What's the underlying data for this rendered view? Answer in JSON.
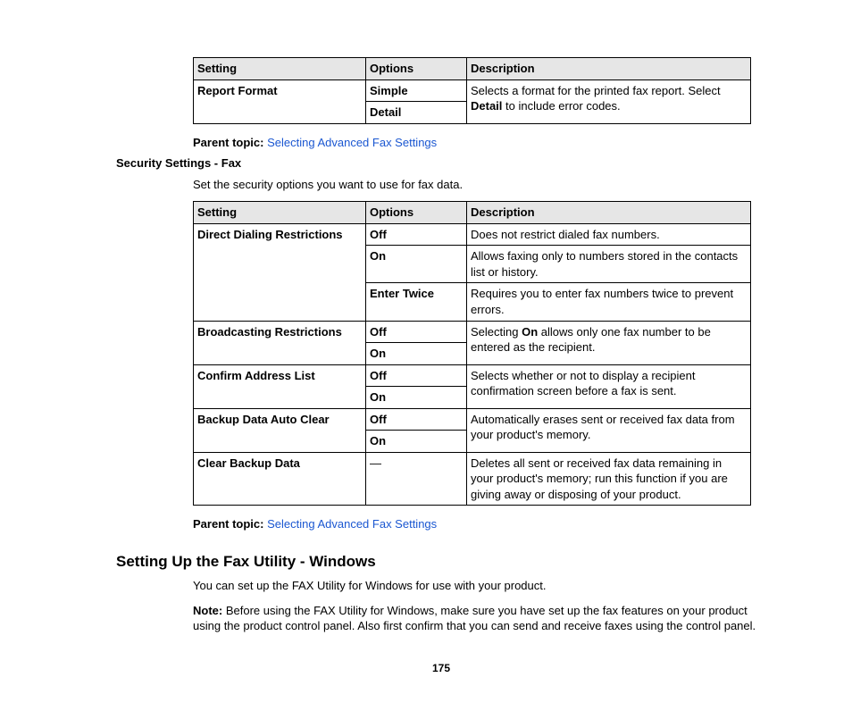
{
  "table1": {
    "headers": {
      "setting": "Setting",
      "options": "Options",
      "description": "Description"
    },
    "row": {
      "setting": "Report Format",
      "opt1": "Simple",
      "opt2": "Detail",
      "desc_pre": "Selects a format for the printed fax report. Select ",
      "desc_bold": "Detail",
      "desc_post": " to include error codes."
    }
  },
  "parent1": {
    "label": "Parent topic:",
    "link": "Selecting Advanced Fax Settings"
  },
  "security": {
    "heading": "Security Settings - Fax",
    "intro": "Set the security options you want to use for fax data."
  },
  "table2": {
    "headers": {
      "setting": "Setting",
      "options": "Options",
      "description": "Description"
    },
    "r1": {
      "setting": "Direct Dialing Restrictions",
      "opt_off": "Off",
      "desc_off": "Does not restrict dialed fax numbers.",
      "opt_on": "On",
      "desc_on": "Allows faxing only to numbers stored in the contacts list or history.",
      "opt_et": "Enter Twice",
      "desc_et": "Requires you to enter fax numbers twice to prevent errors."
    },
    "r2": {
      "setting": "Broadcasting Restrictions",
      "opt_off": "Off",
      "opt_on": "On",
      "desc_pre": "Selecting ",
      "desc_bold": "On",
      "desc_post": " allows only one fax number to be entered as the recipient."
    },
    "r3": {
      "setting": "Confirm Address List",
      "opt_off": "Off",
      "opt_on": "On",
      "desc": "Selects whether or not to display a recipient confirmation screen before a fax is sent."
    },
    "r4": {
      "setting": "Backup Data Auto Clear",
      "opt_off": "Off",
      "opt_on": "On",
      "desc": "Automatically erases sent or received fax data from your product's memory."
    },
    "r5": {
      "setting": "Clear Backup Data",
      "opt": "—",
      "desc": "Deletes all sent or received fax data remaining in your product's memory; run this function if you are giving away or disposing of your product."
    }
  },
  "parent2": {
    "label": "Parent topic:",
    "link": "Selecting Advanced Fax Settings"
  },
  "util": {
    "heading": "Setting Up the Fax Utility - Windows",
    "intro": "You can set up the FAX Utility for Windows for use with your product.",
    "note_label": "Note:",
    "note_text": " Before using the FAX Utility for Windows, make sure you have set up the fax features on your product using the product control panel. Also first confirm that you can send and receive faxes using the control panel."
  },
  "page": "175"
}
